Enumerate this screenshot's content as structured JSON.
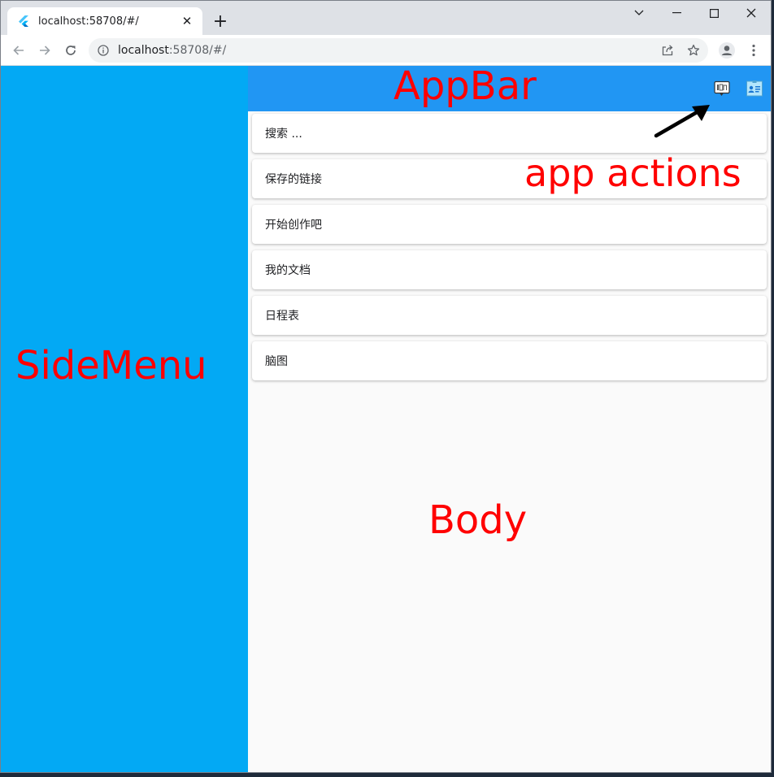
{
  "browser": {
    "tab_title": "localhost:58708/#/",
    "tab_close_glyph": "✕",
    "new_tab_glyph": "+",
    "url_host": "localhost",
    "url_rest": ":58708/#/"
  },
  "appbar": {
    "actions": [
      {
        "icon": "language-icon"
      },
      {
        "icon": "contact-card-icon"
      }
    ]
  },
  "body": {
    "menu_items": [
      {
        "label": "搜索 ..."
      },
      {
        "label": "保存的链接"
      },
      {
        "label": "开始创作吧"
      },
      {
        "label": "我的文档"
      },
      {
        "label": "日程表"
      },
      {
        "label": "脑图"
      }
    ]
  },
  "annotations": {
    "appbar": "AppBar",
    "app_actions": "app actions",
    "sidemenu": "SideMenu",
    "body": "Body"
  },
  "colors": {
    "sidemenu": "#03a9f4",
    "appbar": "#2196f3",
    "body": "#fafafa",
    "annotation": "#ff0000"
  }
}
